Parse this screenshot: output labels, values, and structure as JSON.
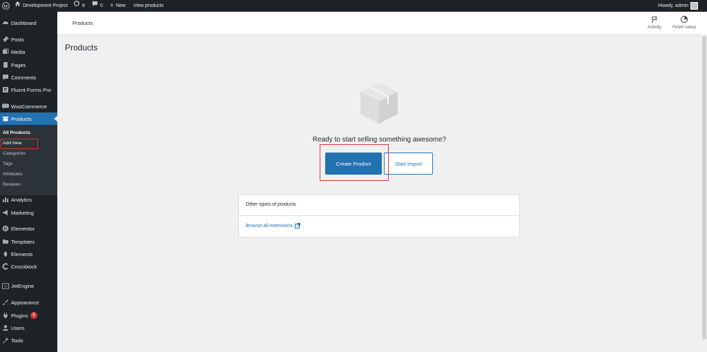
{
  "admin_bar": {
    "site_name": "Development Project",
    "updates_count": "8",
    "comments_count": "0",
    "new_label": "New",
    "view_products_label": "View products",
    "howdy_label": "Howdy, admin"
  },
  "sidebar": {
    "items": [
      {
        "label": "Dashboard",
        "icon": "dashboard-icon"
      },
      {
        "label": "Posts",
        "icon": "pin-icon"
      },
      {
        "label": "Media",
        "icon": "media-icon"
      },
      {
        "label": "Pages",
        "icon": "pages-icon"
      },
      {
        "label": "Comments",
        "icon": "comment-icon"
      },
      {
        "label": "Fluent Forms Pro",
        "icon": "fluent-forms-icon"
      },
      {
        "label": "WooCommerce",
        "icon": "woocommerce-icon"
      },
      {
        "label": "Products",
        "icon": "archive-icon"
      },
      {
        "label": "Analytics",
        "icon": "bar-chart-icon"
      },
      {
        "label": "Marketing",
        "icon": "megaphone-icon"
      },
      {
        "label": "Elementor",
        "icon": "elementor-icon"
      },
      {
        "label": "Templates",
        "icon": "folder-icon"
      },
      {
        "label": "Elements",
        "icon": "elements-icon"
      },
      {
        "label": "Crocoblock",
        "icon": "crocoblock-icon"
      },
      {
        "label": "JetEngine",
        "icon": "jetengine-icon"
      },
      {
        "label": "Appearance",
        "icon": "brush-icon"
      },
      {
        "label": "Plugins",
        "icon": "plug-icon",
        "badge": "5"
      },
      {
        "label": "Users",
        "icon": "user-icon"
      },
      {
        "label": "Tools",
        "icon": "wrench-icon"
      }
    ],
    "submenu": [
      "All Products",
      "Add New",
      "Categories",
      "Tags",
      "Attributes",
      "Reviews"
    ]
  },
  "header": {
    "breadcrumb": "Products",
    "activity_label": "Activity",
    "finish_setup_label": "Finish setup"
  },
  "main": {
    "page_title": "Products",
    "empty_heading": "Ready to start selling something awesome?",
    "create_button": "Create Product",
    "import_button": "Start Import",
    "other_types_title": "Other types of products",
    "browse_link": "Browse all extensions"
  },
  "colors": {
    "sidebar_bg": "#1d2327",
    "accent": "#2271b1",
    "highlight_border": "#d63638",
    "page_bg": "#f0f0f1"
  }
}
